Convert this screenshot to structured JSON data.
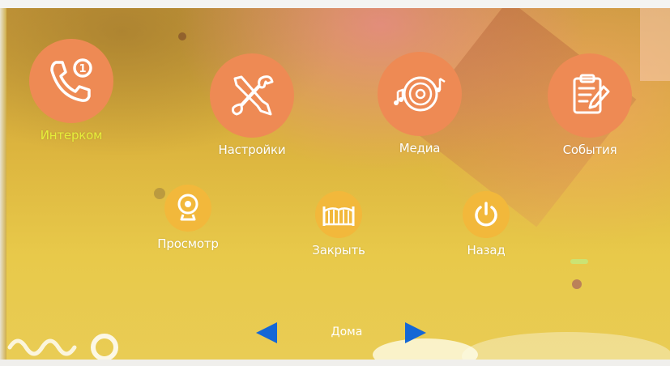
{
  "apps": {
    "intercom": {
      "label": "Интерком",
      "icon": "phone-call-icon",
      "badge": "1",
      "selected": true
    },
    "settings": {
      "label": "Настройки",
      "icon": "wrench-screwdriver-icon"
    },
    "media": {
      "label": "Медиа",
      "icon": "music-disc-icon"
    },
    "events": {
      "label": "События",
      "icon": "clipboard-edit-icon"
    },
    "view": {
      "label": "Просмотр",
      "icon": "webcam-icon"
    },
    "close": {
      "label": "Закрыть",
      "icon": "gate-icon"
    },
    "back": {
      "label": "Назад",
      "icon": "power-icon"
    }
  },
  "pager": {
    "current_page": "Дома"
  },
  "colors": {
    "big_circle": "#ee8a54",
    "small_circle": "#f2b83b",
    "selected_label": "#e6ef3a",
    "label": "#ffffff",
    "arrow": "#1467d6"
  }
}
